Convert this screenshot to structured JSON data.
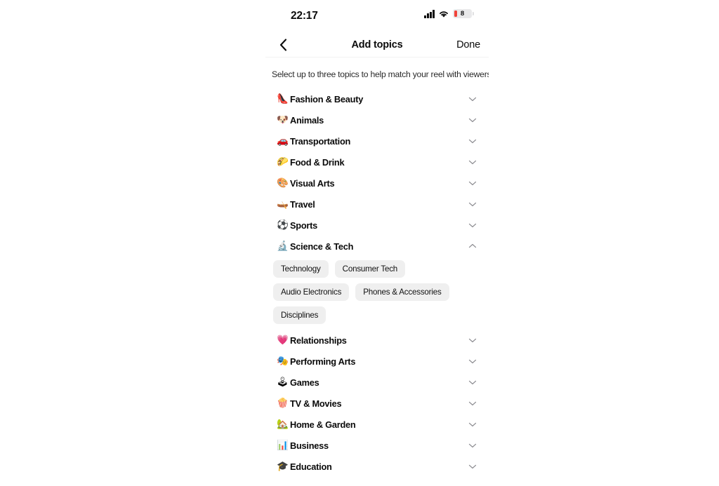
{
  "status_bar": {
    "time": "22:17",
    "signal_icon": "cellular-signal-icon",
    "wifi_icon": "wifi-icon",
    "battery_level": "8",
    "battery_icon": "battery-low-icon",
    "battery_color": "#f0433a"
  },
  "nav": {
    "back_icon": "chevron-left-icon",
    "title": "Add topics",
    "done_label": "Done"
  },
  "subtitle": "Select up to three topics to help match your reel with viewers.",
  "topics": [
    {
      "emoji": "👠",
      "icon_name": "high-heeled-shoe-icon",
      "label": "Fashion & Beauty",
      "expanded": false
    },
    {
      "emoji": "🐶",
      "icon_name": "dog-face-icon",
      "label": "Animals",
      "expanded": false
    },
    {
      "emoji": "🚗",
      "icon_name": "car-icon",
      "label": "Transportation",
      "expanded": false
    },
    {
      "emoji": "🌮",
      "icon_name": "taco-icon",
      "label": "Food & Drink",
      "expanded": false
    },
    {
      "emoji": "🎨",
      "icon_name": "artist-palette-icon",
      "label": "Visual Arts",
      "expanded": false
    },
    {
      "emoji": "🛶",
      "icon_name": "travel-icon",
      "label": "Travel",
      "expanded": false
    },
    {
      "emoji": "⚽",
      "icon_name": "soccer-ball-icon",
      "label": "Sports",
      "expanded": false
    },
    {
      "emoji": "🔬",
      "icon_name": "microscope-icon",
      "label": "Science & Tech",
      "expanded": true,
      "subtopics": [
        "Technology",
        "Consumer Tech",
        "Audio Electronics",
        "Phones & Accessories",
        "Disciplines"
      ]
    },
    {
      "emoji": "💗",
      "icon_name": "growing-heart-icon",
      "label": "Relationships",
      "expanded": false
    },
    {
      "emoji": "🎭",
      "icon_name": "performing-arts-masks-icon",
      "label": "Performing Arts",
      "expanded": false
    },
    {
      "emoji": "🕹",
      "icon_name": "joystick-icon",
      "label": "Games",
      "expanded": false
    },
    {
      "emoji": "🍿",
      "icon_name": "popcorn-icon",
      "label": "TV & Movies",
      "expanded": false
    },
    {
      "emoji": "🏡",
      "icon_name": "house-with-garden-icon",
      "label": "Home & Garden",
      "expanded": false
    },
    {
      "emoji": "📊",
      "icon_name": "bar-chart-icon",
      "label": "Business",
      "expanded": false
    },
    {
      "emoji": "🎓",
      "icon_name": "graduation-cap-icon",
      "label": "Education",
      "expanded": false
    }
  ],
  "colors": {
    "chip_background": "#efefef",
    "chevron": "#8e8e93",
    "text_primary": "#0a0a0a"
  }
}
